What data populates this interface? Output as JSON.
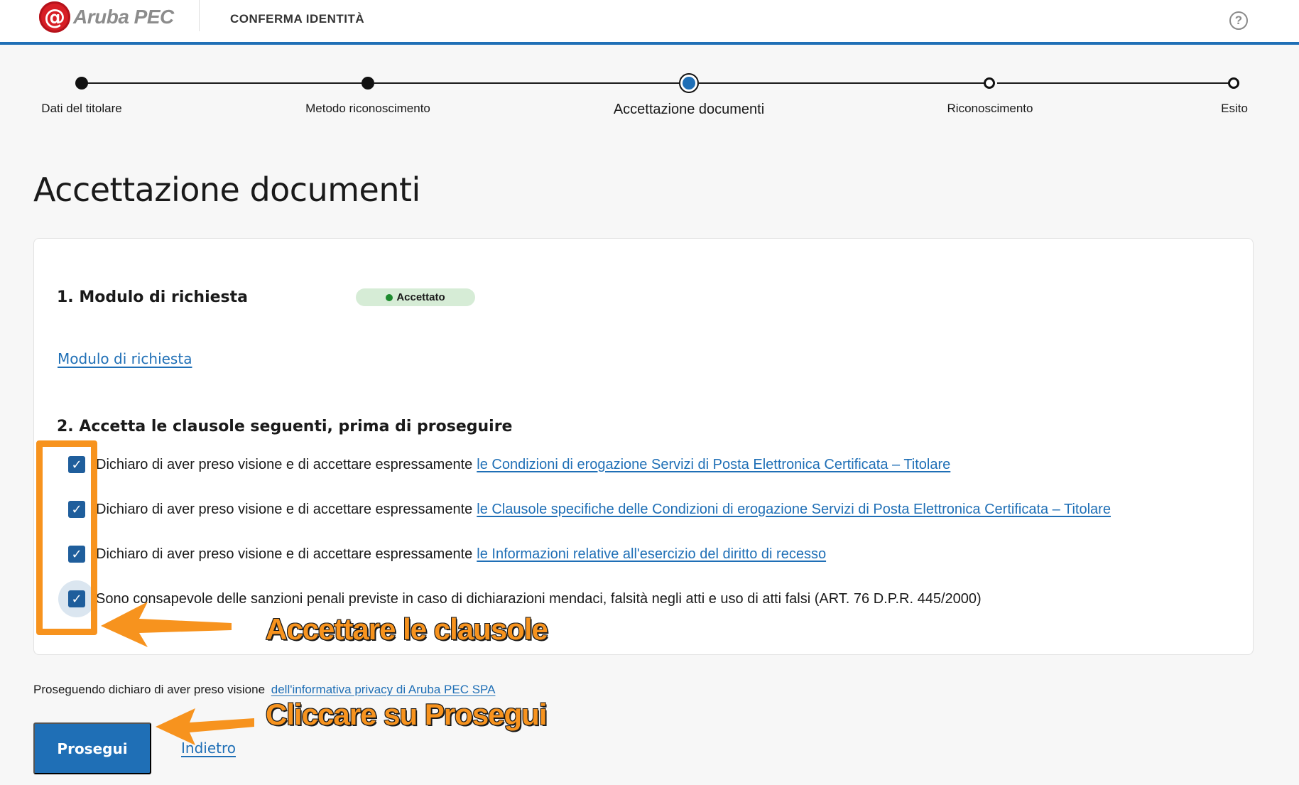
{
  "header": {
    "logo_symbol": "@",
    "logo_text": "Aruba PEC",
    "title": "CONFERMA IDENTITÀ",
    "help_symbol": "?"
  },
  "stepper": {
    "steps": [
      {
        "label": "Dati del titolare",
        "state": "done"
      },
      {
        "label": "Metodo riconoscimento",
        "state": "done"
      },
      {
        "label": "Accettazione documenti",
        "state": "active"
      },
      {
        "label": "Riconoscimento",
        "state": "todo"
      },
      {
        "label": "Esito",
        "state": "todo"
      }
    ]
  },
  "page": {
    "title": "Accettazione documenti"
  },
  "section1": {
    "title": "1.  Modulo di richiesta",
    "badge": "Accettato",
    "badge_color": "#1d8a2e",
    "link": "Modulo di richiesta"
  },
  "section2": {
    "title": "2.  Accetta le clausole seguenti, prima di proseguire",
    "clauses": [
      {
        "text": "Dichiaro di aver preso visione e di accettare espressamente",
        "link": "le Condizioni di erogazione Servizi di Posta Elettronica Certificata – Titolare",
        "checked": true
      },
      {
        "text": "Dichiaro di aver preso visione e di accettare espressamente",
        "link": "le Clausole specifiche delle Condizioni di erogazione Servizi di Posta Elettronica Certificata – Titolare",
        "checked": true
      },
      {
        "text": "Dichiaro di aver preso visione e di accettare espressamente",
        "link": "le Informazioni relative all'esercizio del diritto di recesso",
        "checked": true
      },
      {
        "text": "Sono consapevole delle sanzioni penali previste in caso di dichiarazioni mendaci, falsità negli atti e uso di atti falsi (ART. 76 D.P.R. 445/2000)",
        "checked": true
      }
    ]
  },
  "annotations": {
    "callout_clauses": "Accettare le clausole",
    "callout_continue": "Cliccare su Prosegui",
    "color": "#f7931e"
  },
  "footer": {
    "privacy_text": "Proseguendo dichiaro di aver preso visione",
    "privacy_link": "dell'informativa privacy di Aruba PEC SPA",
    "primary_button": "Prosegui",
    "back_link": "Indietro"
  },
  "colors": {
    "accent": "#1f6fb6",
    "checkbox": "#1f5e9c"
  }
}
